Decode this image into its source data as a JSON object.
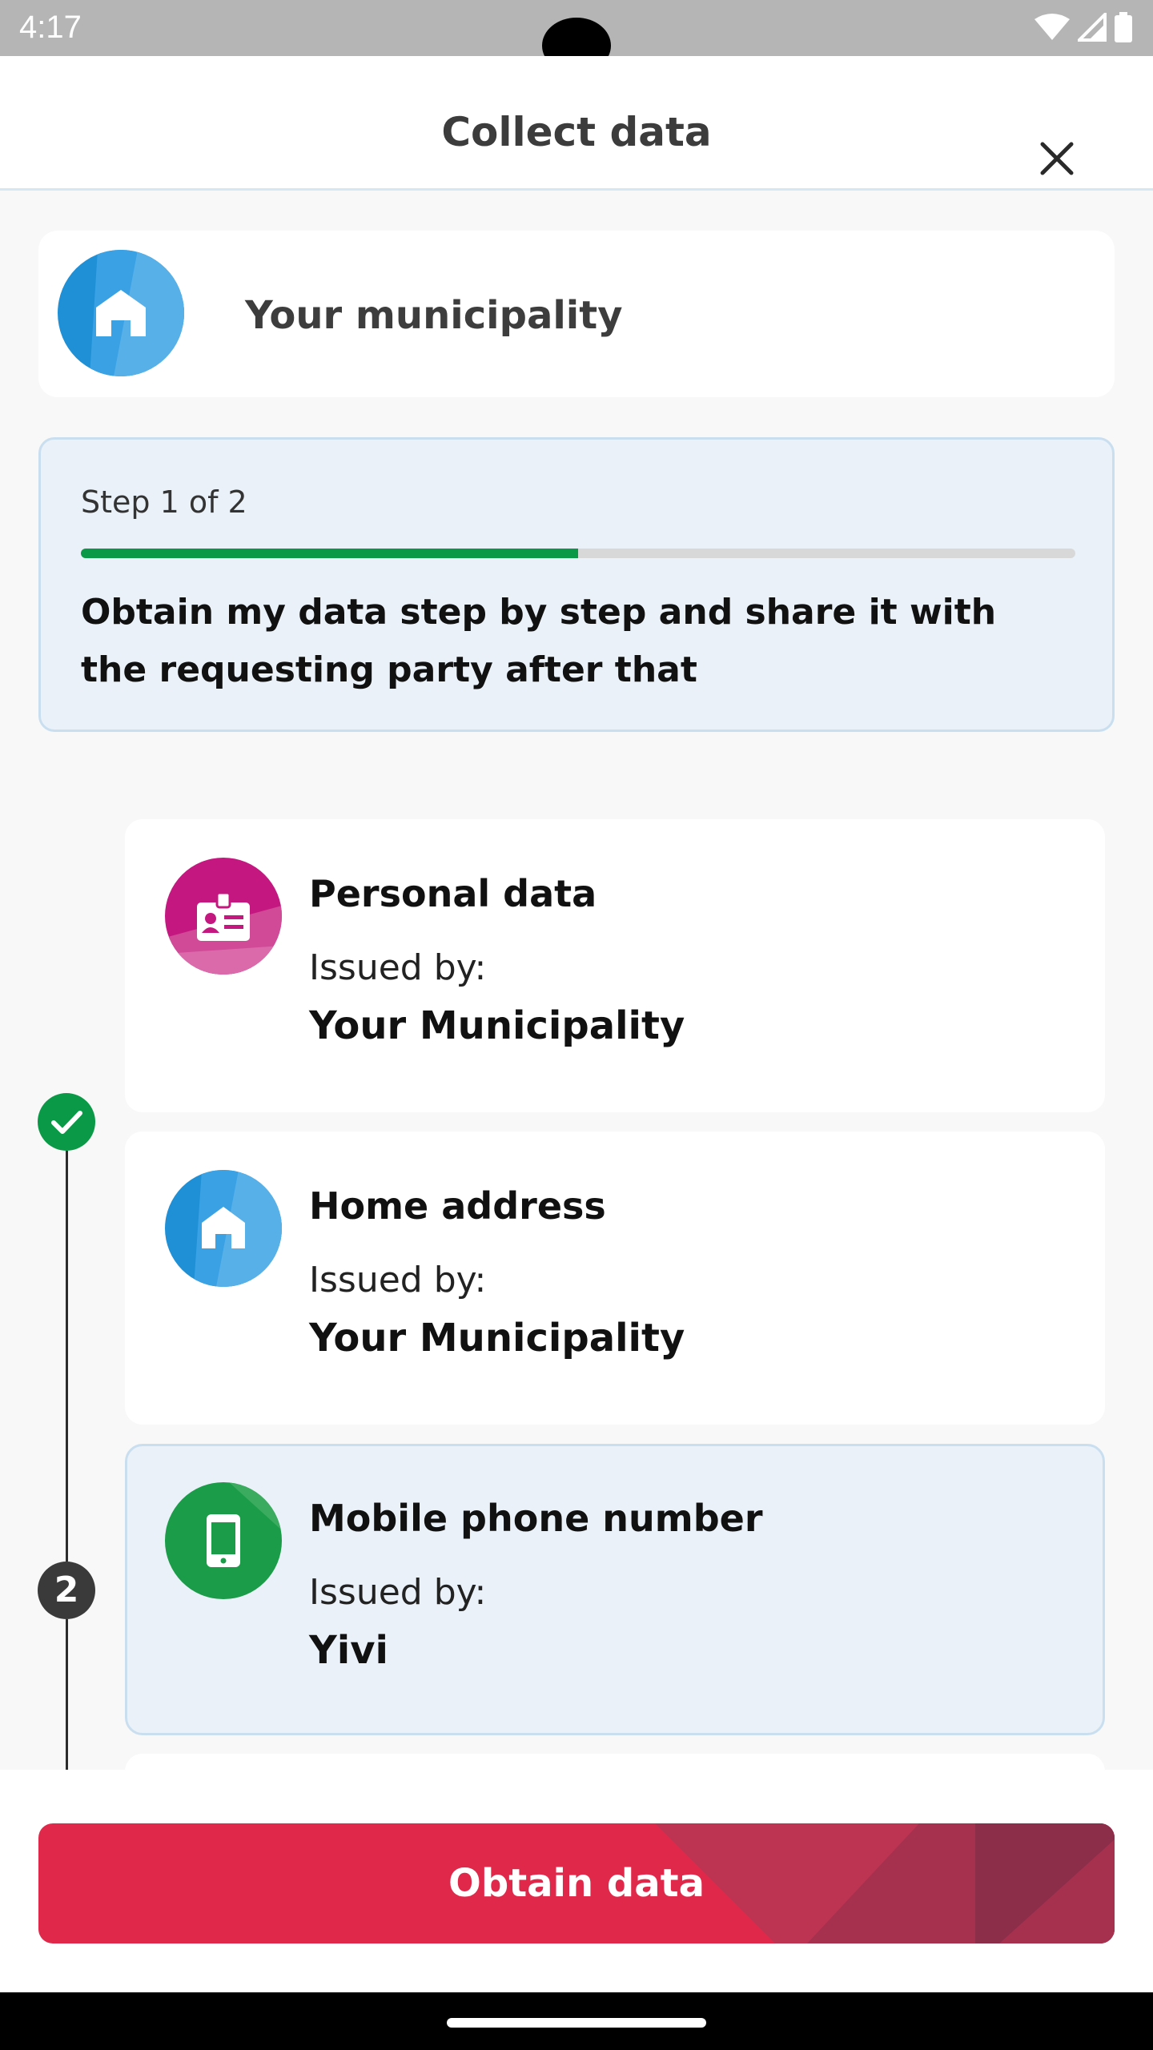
{
  "status_bar": {
    "time": "4:17"
  },
  "header": {
    "title": "Collect data"
  },
  "issuer": {
    "name": "Your municipality"
  },
  "progress": {
    "step_label": "Step 1 of 2",
    "fraction": 0.5,
    "description": "Obtain my data step by step and share it with the requesting party after that"
  },
  "timeline": {
    "step_two_number": "2"
  },
  "credentials": [
    {
      "title": "Personal data",
      "issued_by_label": "Issued by:",
      "issuer": "Your Municipality",
      "icon": "id-badge-icon",
      "color": "#c41880"
    },
    {
      "title": "Home address",
      "issued_by_label": "Issued by:",
      "issuer": "Your Municipality",
      "icon": "home-icon",
      "color": "#1f8fd6"
    },
    {
      "title": "Mobile phone number",
      "issued_by_label": "Issued by:",
      "issuer": "Yivi",
      "icon": "mobile-phone-icon",
      "color": "#1a9c49"
    }
  ],
  "action": {
    "button_label": "Obtain data"
  },
  "colors": {
    "accent_red": "#e0284a",
    "progress_green": "#0a9a47",
    "highlight_bg": "#eaf1f8"
  }
}
